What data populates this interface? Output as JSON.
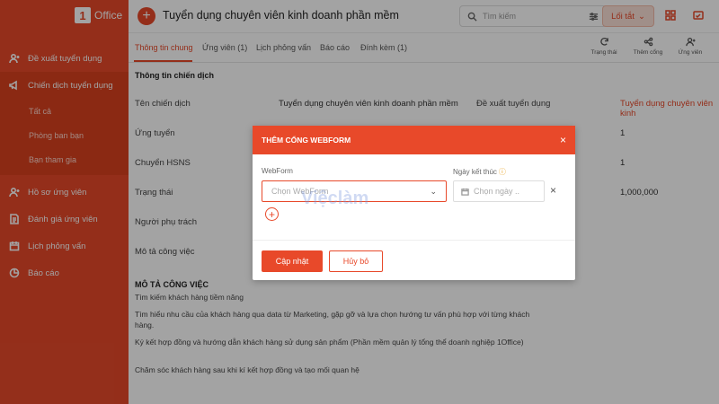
{
  "brand": {
    "logo_mark": "1",
    "logo_text": "Office"
  },
  "sidebar": {
    "items": [
      {
        "label": "Đề xuất tuyển dụng",
        "icon": "user-plus-icon"
      },
      {
        "label": "Chiến dịch tuyển dụng",
        "icon": "megaphone-icon"
      },
      {
        "label": "Hồ sơ ứng viên",
        "icon": "user-plus-icon"
      },
      {
        "label": "Đánh giá ứng viên",
        "icon": "document-icon"
      },
      {
        "label": "Lịch phỏng vấn",
        "icon": "calendar-icon"
      },
      {
        "label": "Báo cáo",
        "icon": "pie-chart-icon"
      }
    ],
    "sub_items": [
      "Tất cả",
      "Phòng ban bạn",
      "Bạn tham gia"
    ]
  },
  "topbar": {
    "title": "Tuyển dụng chuyên viên kinh doanh phần mềm",
    "search_placeholder": "Tìm kiếm",
    "shortcut_label": "Lối tắt"
  },
  "tabs": [
    "Thông tin chung",
    "Ứng viên (1)",
    "Lịch phỏng vấn",
    "Báo cáo",
    "Đính kèm (1)"
  ],
  "tools": [
    "Trạng thái",
    "Thêm cổng",
    "Ứng viên"
  ],
  "campaign": {
    "section_title": "Thông tin chiến dịch",
    "rows": [
      {
        "label": "Tên chiến dịch",
        "value": "Tuyển dụng chuyên viên kinh doanh phần mềm"
      },
      {
        "label": "Ứng tuyển",
        "value": ""
      },
      {
        "label": "Chuyển HSNS",
        "value": ""
      },
      {
        "label": "Trạng thái",
        "value": ""
      },
      {
        "label": "Người phụ trách",
        "value": ""
      },
      {
        "label": "Mô tả công việc",
        "value": ""
      }
    ],
    "right_label": "Đề xuất tuyển dụng",
    "right_values": [
      "Tuyển dụng chuyên viên kinh",
      "1",
      "1",
      "1,000,000"
    ]
  },
  "description": {
    "title": "MÔ TẢ CÔNG VIỆC",
    "lines": [
      "Tìm kiếm khách hàng tiềm năng",
      "Tìm hiểu nhu cầu của khách hàng qua data từ Marketing, gặp gỡ và lựa chọn hướng tư vấn phù hợp với từng khách hàng.",
      "Ký kết hợp đồng và hướng dẫn khách hàng sử dụng sản phẩm (Phần mềm quản lý tổng thể doanh nghiệp 1Office)",
      "Chăm sóc khách hàng sau khi kí kết hợp đồng và tạo mối quan hệ"
    ]
  },
  "modal": {
    "title": "THÊM CỔNG WEBFORM",
    "close": "×",
    "webform_label": "WebForm",
    "webform_placeholder": "Chọn WebForm",
    "end_date_label": "Ngày kết thúc",
    "end_date_placeholder": "Chọn ngày ..",
    "clear": "×",
    "add": "+",
    "submit_label": "Cập nhật",
    "cancel_label": "Hủy bỏ"
  },
  "watermark": "Việclàm",
  "colors": {
    "accent": "#e8492a",
    "sidebar": "#e8492a"
  }
}
